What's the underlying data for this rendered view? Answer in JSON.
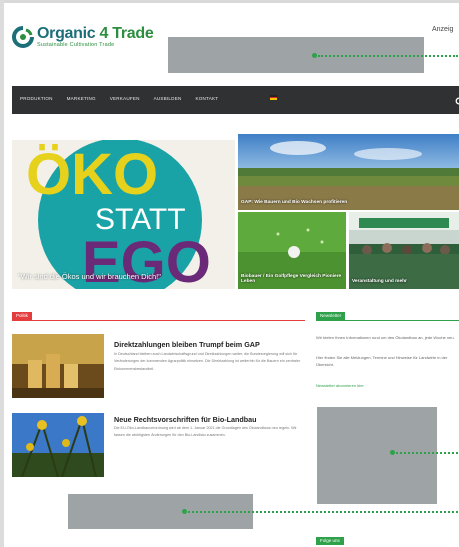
{
  "header": {
    "logo_title_a": "Organic ",
    "logo_title_b": "4",
    "logo_title_c": " Trade",
    "logo_subtitle": "Sustainable Cultivation Trade",
    "top_link": "Anzeig"
  },
  "nav": {
    "items": [
      "PRODUKTION",
      "MARKETING",
      "VERKAUFEN",
      "AUSBILDEN",
      "KONTAKT"
    ]
  },
  "hero": {
    "main_word_1": "ÖKO",
    "main_word_2": "STATT",
    "main_word_3": "EGO",
    "main_caption": "\"Wir sind die Ökos und wir brauchen Dich!\"",
    "tile_field_caption": "GAP: Wie Bauern und Bio Wachsen profitieren",
    "tile_golf_caption": "Biobauer / Ein Golfpflege Vergleich Pioniere Leben",
    "tile_event_caption": "Veranstaltung und mehr"
  },
  "sections": {
    "news_label": "Politik",
    "sidebar_label": "Newsletter",
    "sidebar_label_2": "Folge uns"
  },
  "articles": [
    {
      "title": "Direktzahlungen bleiben Trumpf beim GAP",
      "body": "In Deutschland bleiben auch Landwirtschaftsgrund und Direktzahlungen weiter, die Bundesregierung will sich für Veränderungen der kommenden Agrarpolitik einsetzen. Die Direktzahlung ist weiterhin für die Bauern ein zentraler Einkommensbestandteil."
    },
    {
      "title": "Neue Rechtsvorschriften für Bio-Landbau",
      "body": "Die EU-Öko-Landbauverordnung wird ab dem 1. Januar 2021 die Grundlagen des Ökolandbaus neu regeln. Wir fassen die wichtigsten Änderungen für den Bio-Landbau zusammen."
    }
  ],
  "sidebar": {
    "text_1": "Wir bieten Ihnen Informationen rund um den Ökolandbau an, jede Woche neu.",
    "text_2": "Hier finden Sie alle Meldungen, Termine und Hinweise für Landwirte in der Übersicht.",
    "link": "Newsletter abonnieren hier"
  },
  "colors": {
    "nav_bg": "#2f3133",
    "accent_green": "#2ea14a",
    "accent_red": "#e43d3d",
    "logo_teal": "#1c6f78",
    "placeholder_gray": "#9ea3a6"
  }
}
